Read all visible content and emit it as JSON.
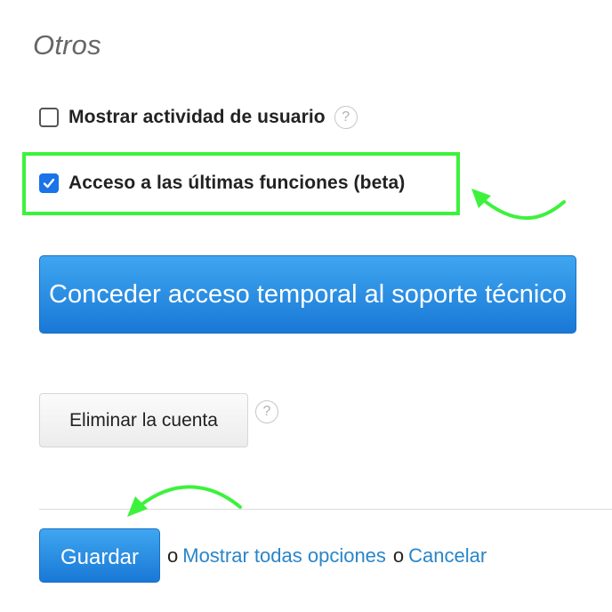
{
  "section": {
    "title": "Otros"
  },
  "options": [
    {
      "label": "Mostrar actividad de usuario",
      "checked": false,
      "help": "?"
    },
    {
      "label": "Acceso a las últimas funciones (beta)",
      "checked": true
    }
  ],
  "buttons": {
    "support": "Conceder acceso temporal al soporte técnico",
    "delete": "Eliminar la cuenta",
    "delete_help": "?"
  },
  "footer": {
    "save": "Guardar",
    "or1": "o",
    "show_all": "Mostrar todas opciones",
    "or2": "o",
    "cancel": "Cancelar"
  },
  "colors": {
    "accent": "#1a73e8",
    "highlight": "#3cf23c",
    "link": "#2a85c8"
  }
}
